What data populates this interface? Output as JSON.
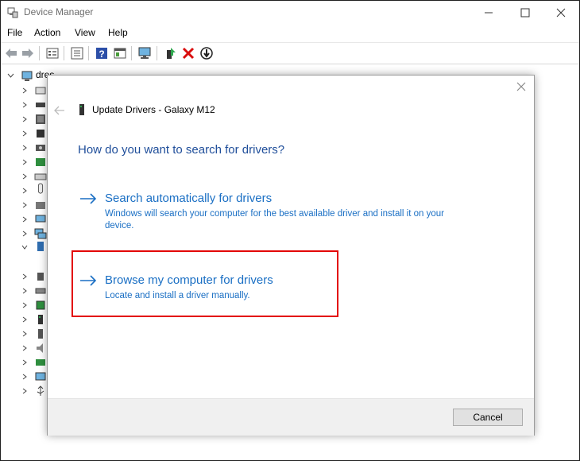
{
  "window": {
    "title": "Device Manager"
  },
  "menu": [
    "File",
    "Action",
    "View",
    "Help"
  ],
  "toolbar_icons": [
    "back-icon",
    "forward-icon",
    "properties-icon",
    "help-icon",
    "list-view-icon",
    "scan-hardware-icon",
    "update-driver-icon",
    "uninstall-icon",
    "disable-icon"
  ],
  "tree": {
    "root_label": "dres"
  },
  "dialog": {
    "title": "Update Drivers - Galaxy M12",
    "heading": "How do you want to search for drivers?",
    "options": [
      {
        "title": "Search automatically for drivers",
        "desc": "Windows will search your computer for the best available driver and install it on your device."
      },
      {
        "title": "Browse my computer for drivers",
        "desc": "Locate and install a driver manually."
      }
    ],
    "cancel_label": "Cancel"
  },
  "colors": {
    "link": "#1a6fc4",
    "heading": "#1f4e9a",
    "highlight": "#e30000"
  }
}
